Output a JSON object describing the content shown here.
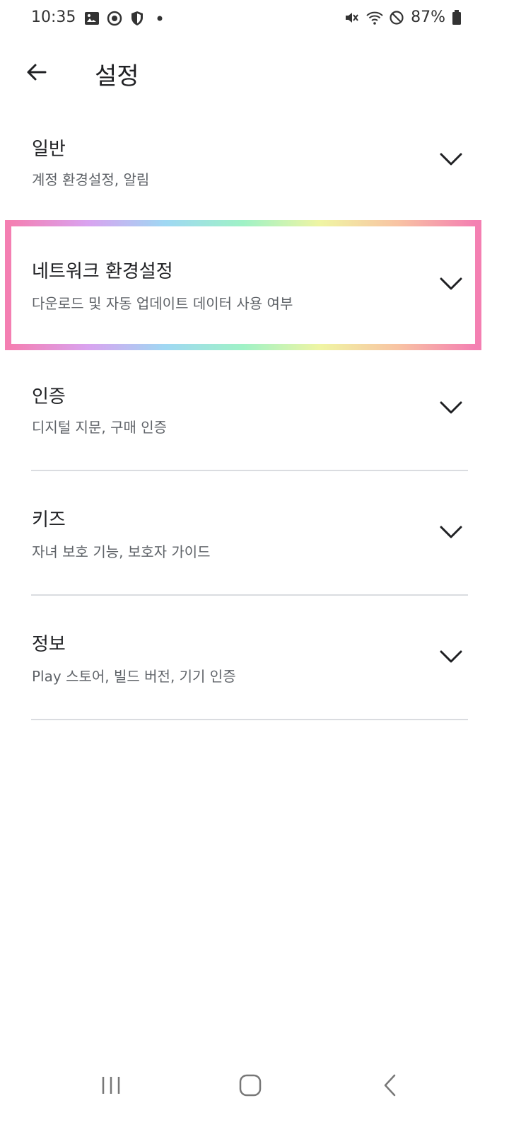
{
  "status": {
    "time": "10:35",
    "battery_text": "87%",
    "left_icons": [
      "gallery-icon",
      "sync-icon",
      "shield-icon",
      "dot-icon"
    ],
    "right_icons": [
      "mute-icon",
      "wifi-icon",
      "block-icon",
      "battery-icon"
    ]
  },
  "appbar": {
    "title": "설정",
    "back_icon": "arrow-back-icon"
  },
  "sections": [
    {
      "title": "일반",
      "subtitle": "계정 환경설정, 알림"
    },
    {
      "title": "네트워크 환경설정",
      "subtitle": "다운로드 및 자동 업데이트 데이터 사용 여부"
    },
    {
      "title": "인증",
      "subtitle": "디지털 지문, 구매 인증"
    },
    {
      "title": "키즈",
      "subtitle": "자녀 보호 기능, 보호자 가이드"
    },
    {
      "title": "정보",
      "subtitle": "Play 스토어, 빌드 버전, 기기 인증"
    }
  ],
  "navbar": {
    "icons": [
      "recent-apps-icon",
      "home-icon",
      "back-icon"
    ]
  },
  "colors": {
    "text_primary": "#202124",
    "text_secondary": "#5f6368",
    "divider": "#dadce0",
    "highlight_pink": "#f47fb2"
  }
}
